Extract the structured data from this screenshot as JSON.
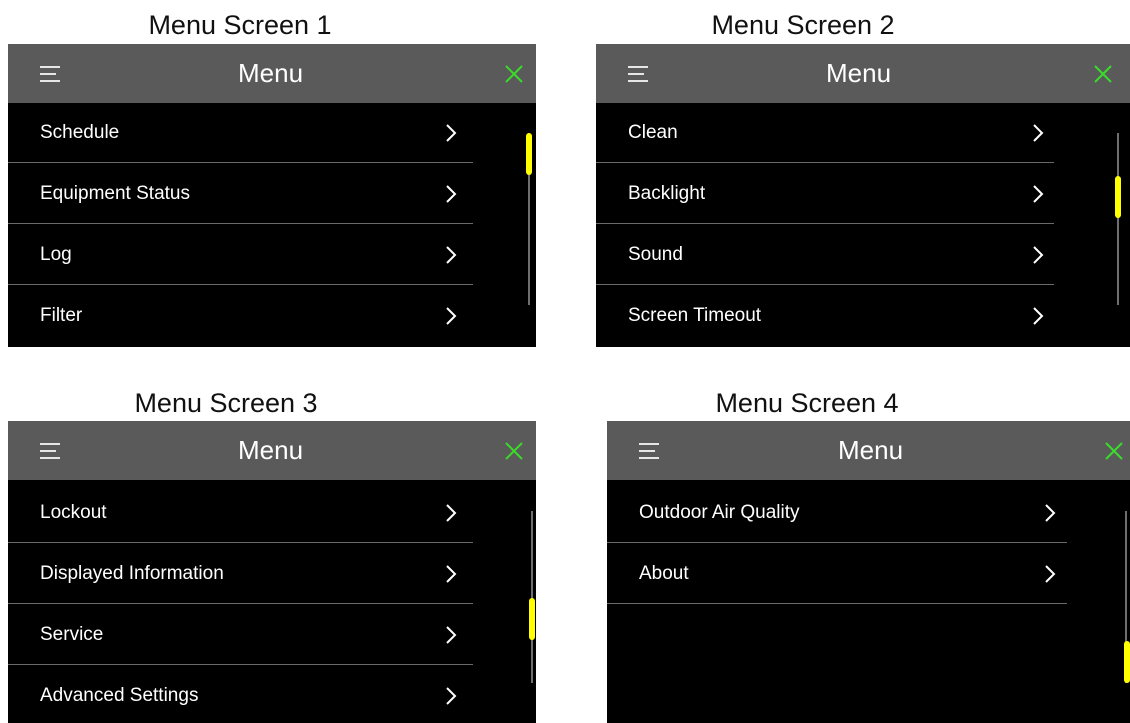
{
  "colors": {
    "header_bg": "#5a5a5a",
    "screen_bg": "#000000",
    "close_icon": "#3adb2a",
    "scroll_thumb": "#ffff00",
    "text": "#ffffff"
  },
  "screens": [
    {
      "caption": "Menu Screen 1",
      "header": {
        "menu_icon": "hamburger-icon",
        "title": "Menu",
        "close_icon": "close-icon"
      },
      "items": [
        {
          "label": "Schedule",
          "icon": "chevron-right-icon"
        },
        {
          "label": "Equipment Status",
          "icon": "chevron-right-icon"
        },
        {
          "label": "Log",
          "icon": "chevron-right-icon"
        },
        {
          "label": "Filter",
          "icon": "chevron-right-icon"
        }
      ],
      "scroll_position": 0.0
    },
    {
      "caption": "Menu Screen 2",
      "header": {
        "menu_icon": "hamburger-icon",
        "title": "Menu",
        "close_icon": "close-icon"
      },
      "items": [
        {
          "label": "Clean",
          "icon": "chevron-right-icon"
        },
        {
          "label": "Backlight",
          "icon": "chevron-right-icon"
        },
        {
          "label": "Sound",
          "icon": "chevron-right-icon"
        },
        {
          "label": "Screen Timeout",
          "icon": "chevron-right-icon"
        }
      ],
      "scroll_position": 0.33
    },
    {
      "caption": "Menu Screen 3",
      "header": {
        "menu_icon": "hamburger-icon",
        "title": "Menu",
        "close_icon": "close-icon"
      },
      "items": [
        {
          "label": "Lockout",
          "icon": "chevron-right-icon"
        },
        {
          "label": "Displayed Information",
          "icon": "chevron-right-icon"
        },
        {
          "label": "Service",
          "icon": "chevron-right-icon"
        },
        {
          "label": "Advanced Settings",
          "icon": "chevron-right-icon"
        }
      ],
      "scroll_position": 0.67
    },
    {
      "caption": "Menu Screen 4",
      "header": {
        "menu_icon": "hamburger-icon",
        "title": "Menu",
        "close_icon": "close-icon"
      },
      "items": [
        {
          "label": "Outdoor Air Quality",
          "icon": "chevron-right-icon"
        },
        {
          "label": "About",
          "icon": "chevron-right-icon"
        }
      ],
      "scroll_position": 1.0
    }
  ]
}
